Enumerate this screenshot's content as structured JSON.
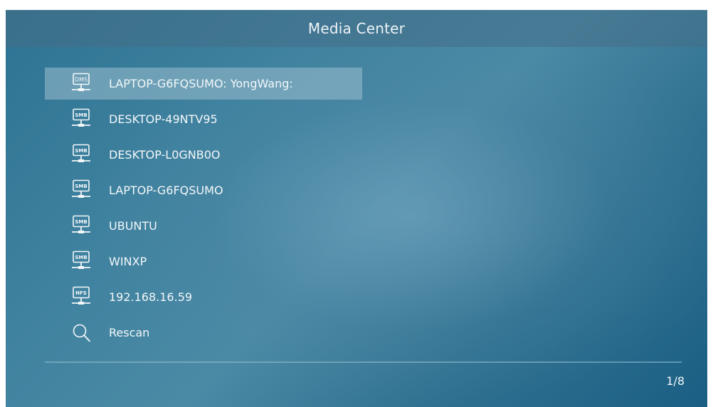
{
  "header": {
    "title": "Media Center"
  },
  "list": {
    "items": [
      {
        "label": "LAPTOP-G6FQSUMO: YongWang:",
        "icon": "dms-server-icon",
        "badge": "DMS",
        "selected": true
      },
      {
        "label": "DESKTOP-49NTV95",
        "icon": "smb-server-icon",
        "badge": "SMB"
      },
      {
        "label": "DESKTOP-L0GNB0O",
        "icon": "smb-server-icon",
        "badge": "SMB"
      },
      {
        "label": "LAPTOP-G6FQSUMO",
        "icon": "smb-server-icon",
        "badge": "SMB"
      },
      {
        "label": "UBUNTU",
        "icon": "smb-server-icon",
        "badge": "SMB"
      },
      {
        "label": "WINXP",
        "icon": "smb-server-icon",
        "badge": "SMB"
      },
      {
        "label": "192.168.16.59",
        "icon": "nfs-server-icon",
        "badge": "NFS"
      },
      {
        "label": "Rescan",
        "icon": "search-icon"
      }
    ]
  },
  "footer": {
    "page_indicator": "1/8"
  },
  "colors": {
    "background": "#3f829f",
    "header": "#466e87",
    "selection": "#9bbecd",
    "text": "#f3f7f9"
  }
}
